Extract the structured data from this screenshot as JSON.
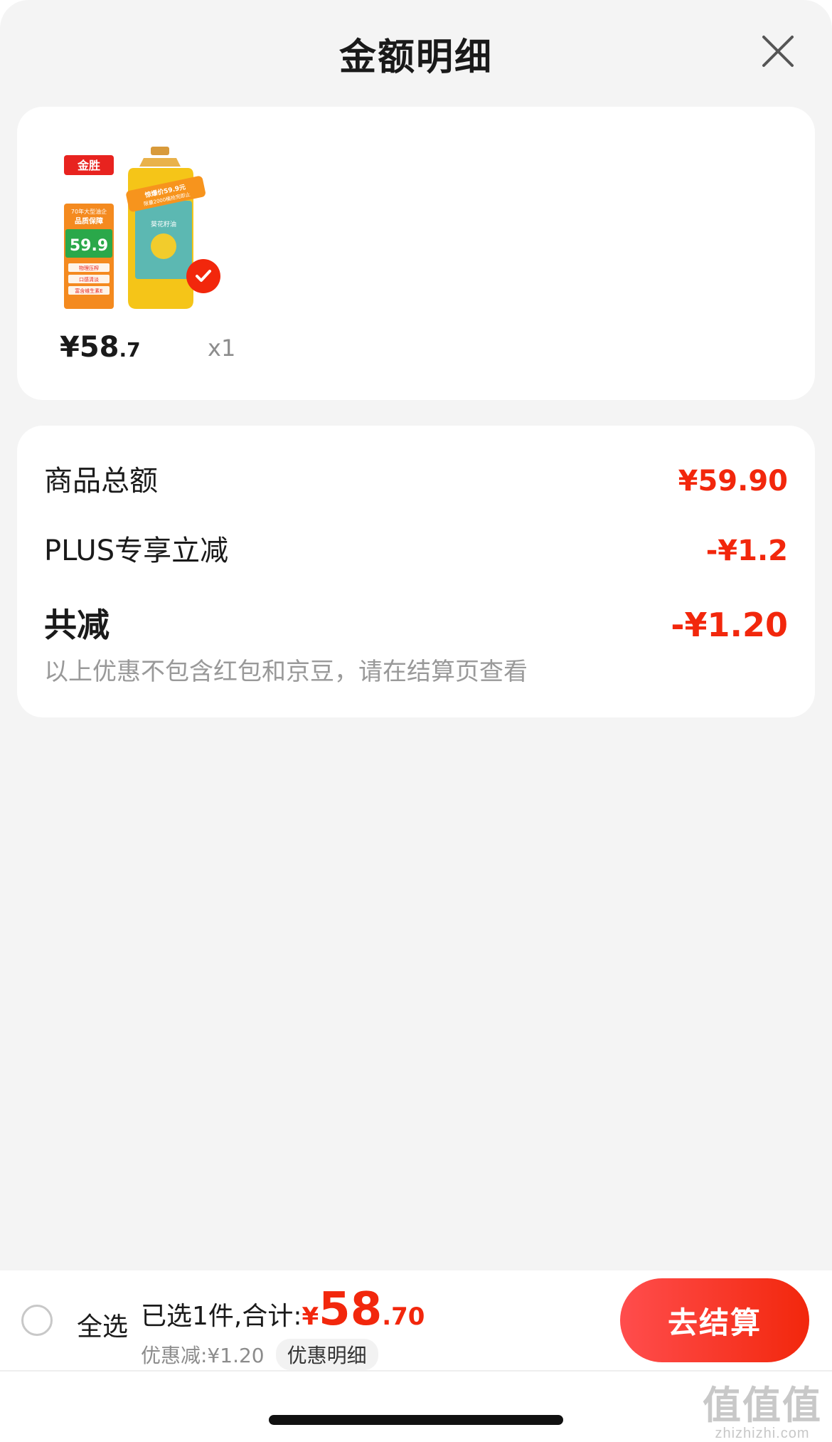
{
  "header": {
    "title": "金额明细"
  },
  "product": {
    "brand_logo_text": "金胜",
    "badge_price": "59.9",
    "badge_lines": [
      "70年大型油企",
      "品质保障",
      "物理压榨",
      "口感清淡",
      "富含维生素E"
    ],
    "bottle_banner": "惊爆价59.9元 限量2000桶抢完即止",
    "price_int": "¥58",
    "price_dec": ".7",
    "quantity": "x1",
    "selected": true
  },
  "summary": {
    "goods_total_label": "商品总额",
    "goods_total_value": "¥59.90",
    "plus_label": "PLUS专享立减",
    "plus_value": "-¥1.2",
    "total_discount_label": "共减",
    "total_discount_value": "-¥1.20",
    "note": "以上优惠不包含红包和京豆，请在结算页查看"
  },
  "bottom_bar": {
    "select_all_label": "全选",
    "selected_text": "已选1件,合计:",
    "total_yen": "¥",
    "total_int": "58",
    "total_dec": ".70",
    "discount_text": "优惠减:¥1.20",
    "discount_detail_label": "优惠明细",
    "checkout_label": "去结算"
  },
  "watermark": {
    "big": "值值值",
    "small": "zhizhizhi.com"
  },
  "colors": {
    "accent": "#f2270c",
    "background": "#f4f4f4"
  }
}
